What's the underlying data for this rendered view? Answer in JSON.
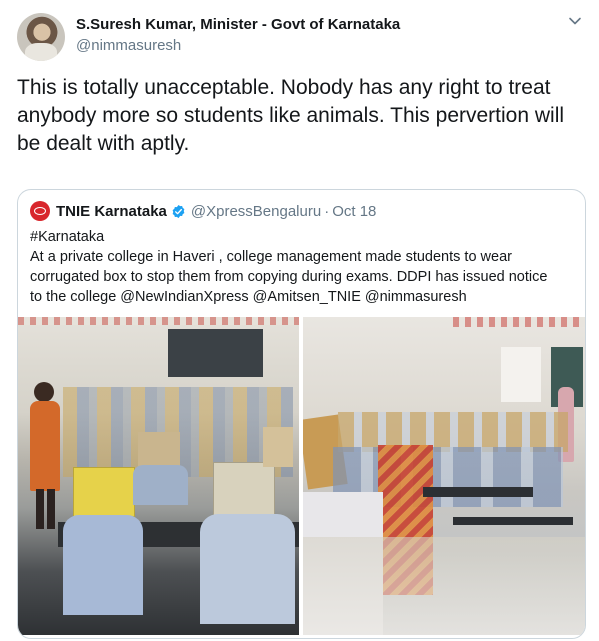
{
  "author": {
    "name": "S.Suresh Kumar, Minister - Govt of Karnataka",
    "handle": "@nimmasuresh"
  },
  "tweet_text": "This is totally unacceptable. Nobody has any right to treat anybody more so students like animals. This pervertion will be dealt with aptly.",
  "icons": {
    "caret": "chevron-down-icon",
    "verified": "verified-badge-icon"
  },
  "colors": {
    "text": "#14171a",
    "secondary": "#657786",
    "border": "#ccd6dd",
    "verified": "#1da1f2",
    "quote_avatar": "#d8262c"
  },
  "quote": {
    "name": "TNIE Karnataka",
    "handle": "@XpressBengaluru",
    "separator": "·",
    "date": "Oct 18",
    "lines": [
      "#Karnataka",
      "At a private college in Haveri , college management made students to wear",
      "corrugated box to stop them from copying during exams. DDPI has issued notice",
      "to the college @NewIndianXpress @Amitsen_TNIE @nimmasuresh"
    ]
  }
}
